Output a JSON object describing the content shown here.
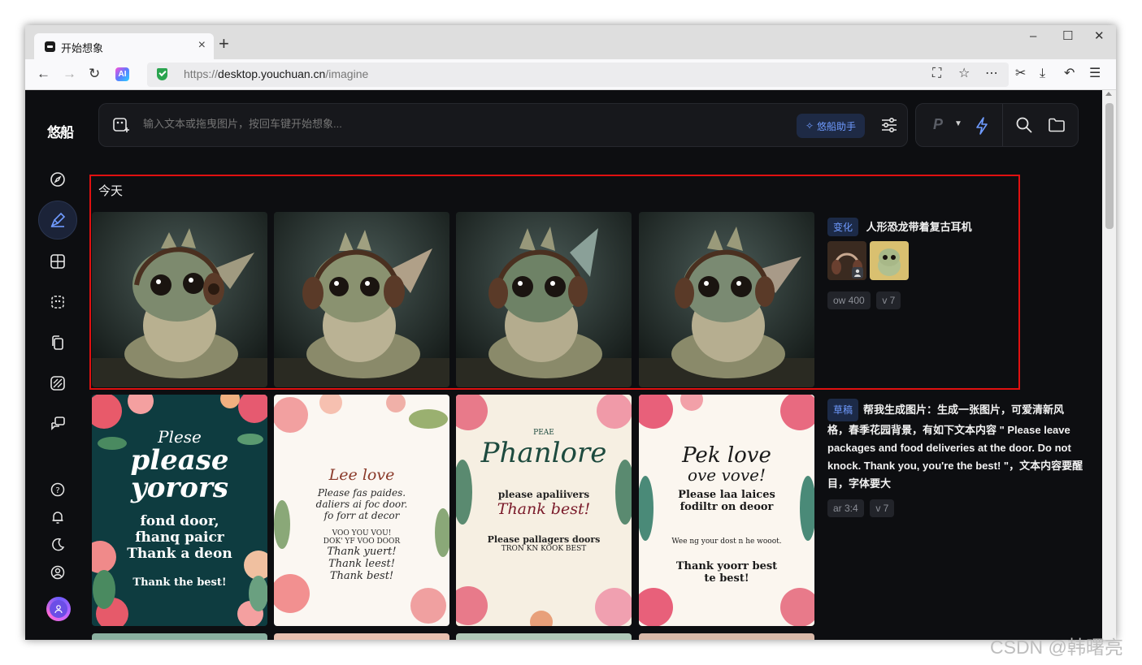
{
  "browser": {
    "tab_title": "开始想象",
    "tab_close": "×",
    "new_tab": "+",
    "url_scheme": "https://",
    "url_host": "desktop.youchuan.cn",
    "url_path": "/imagine",
    "ai_badge": "AI",
    "minimize": "–",
    "maximize": "☐",
    "close": "✕"
  },
  "app": {
    "logo": "悠船",
    "prompt_placeholder": "输入文本或拖曳图片，按回车键开始想象...",
    "assistant_label": "悠船助手",
    "model_label": "P"
  },
  "section": {
    "title": "今天"
  },
  "jobs": [
    {
      "tag": "变化",
      "prompt": "人形恐龙带着复古耳机",
      "params": [
        "ow 400",
        "v 7"
      ]
    },
    {
      "tag": "草稿",
      "prompt": "帮我生成图片：生成一张图片，可爱清新风格，春季花园背景，有如下文本内容 \" Please leave packages and food deliveries at the door. Do not knock. Thank you, you're the best! \"，文本内容要醒目，字体要大",
      "params": [
        "ar 3:4",
        "v 7"
      ]
    }
  ],
  "posters": [
    {
      "lines": [
        "Plese",
        "please",
        "yorors",
        "fond door,",
        "fhanq paicr",
        "Thank a deon",
        "Thank the best!"
      ]
    },
    {
      "lines": [
        "Lee love",
        "Please fas paides.",
        "daliers ai foc door.",
        "fo forr at decor",
        "VOO YOU VOU!",
        "DOK' YF VOO DOOR",
        "Thank yuert!",
        "Thank leest!",
        "Thank best!"
      ]
    },
    {
      "lines": [
        "PEAE",
        "Phanlore",
        "please apaliivers",
        "Thank best!",
        "Please pallagers doors",
        "TRON KN KOOK BEST"
      ]
    },
    {
      "lines": [
        "Pek love",
        "ove vove!",
        "Please laa laices",
        "fodiltr on deoor",
        "Wee ng your dost n he wooot.",
        "Thank yoorr best",
        "te best!"
      ]
    }
  ],
  "watermark": "CSDN @韩曙亮",
  "colors": {
    "accent": "#6f9bff",
    "highlight_border": "#e01010",
    "app_bg": "#0d0e11"
  }
}
